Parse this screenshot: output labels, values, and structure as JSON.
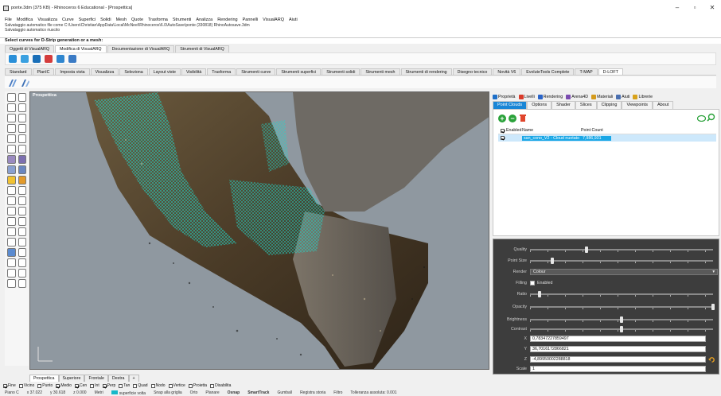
{
  "window": {
    "title": "ponte.3dm (375 KB) - Rhinoceros 6 Educational - [Prospettica]",
    "buttons": [
      "–",
      "▫",
      "✕"
    ]
  },
  "menu": [
    "File",
    "Modifica",
    "Visualizza",
    "Curve",
    "Superfici",
    "Solidi",
    "Mesh",
    "Quote",
    "Trasforma",
    "Strumenti",
    "Analizza",
    "Rendering",
    "Pannelli",
    "VisualARQ",
    "Aiuti"
  ],
  "command_history": [
    "Salvataggio automatico file come C:\\Users\\Christian\\AppData\\Local\\McNeel\\Rhinoceros\\6.0\\AutoSave\\ponte (330818) RhinoAutosave.3dm",
    "Salvataggio automatico riuscito"
  ],
  "command_prompt": "Select curves for D-Strip generation or a mesh:",
  "toolbar_tabs_top": [
    "Oggetti di VisualARQ",
    "Modifica di VisualARQ",
    "Documentazione di VisualARQ",
    "Strumenti di VisualARQ"
  ],
  "toolbar_tabs_top_active": 1,
  "toolbar_tabs_main": [
    "Standard",
    "PlanIC",
    "Imposta vista",
    "Visualizza",
    "Seleziona",
    "Layout viste",
    "Visibilità",
    "Trasforma",
    "Strumenti curve",
    "Strumenti superfici",
    "Strumenti solidi",
    "Strumenti mesh",
    "Strumenti di rendering",
    "Disegno tecnico",
    "Novità V6",
    "EvoluteTools Complete",
    "T-MAP",
    "D-LOFT"
  ],
  "toolbar_tabs_main_active": 17,
  "viewport": {
    "label": "Prospettica",
    "tabs": [
      "Prospettica",
      "Superiore",
      "Frontale",
      "Destra",
      "+"
    ],
    "active_tab": 0
  },
  "osnaps": [
    {
      "label": "Fine",
      "checked": true
    },
    {
      "label": "Vicino",
      "checked": false
    },
    {
      "label": "Punto",
      "checked": false
    },
    {
      "label": "Medio",
      "checked": true
    },
    {
      "label": "Cen",
      "checked": true
    },
    {
      "label": "Int",
      "checked": false
    },
    {
      "label": "Perp",
      "checked": true
    },
    {
      "label": "Tan",
      "checked": false
    },
    {
      "label": "Quad",
      "checked": false
    },
    {
      "label": "Nodo",
      "checked": false
    },
    {
      "label": "Vertice",
      "checked": false
    },
    {
      "label": "Proietta",
      "checked": false
    },
    {
      "label": "Disabilita",
      "checked": false
    }
  ],
  "status": {
    "plane": "Piano C",
    "x": "x 37.022",
    "y": "y 30.618",
    "z": "z 0.000",
    "units": "Metri",
    "layer": "superficie volta",
    "items": [
      "Snap alla griglia",
      "Orto",
      "Planare",
      "Osnap",
      "SmartTrack",
      "Gumball",
      "Registra storia",
      "Filtro",
      "Tolleranza assoluta: 0.001"
    ]
  },
  "panel_tabs": [
    {
      "label": "Proprietà",
      "color": "#1e6fc8"
    },
    {
      "label": "Livelli",
      "color": "#d93a2a"
    },
    {
      "label": "Rendering",
      "color": "#2a64c8"
    },
    {
      "label": "Arena4D",
      "color": "#7a4bb0"
    },
    {
      "label": "Materiali",
      "color": "#d49a1c"
    },
    {
      "label": "Aiuti",
      "color": "#4a6fb0"
    },
    {
      "label": "Librerie",
      "color": "#d8a21a"
    }
  ],
  "pc_subtabs": [
    "Point Clouds",
    "Options",
    "Shader",
    "Slices",
    "Clipping",
    "Viewpoints",
    "About"
  ],
  "pc_subtabs_active": 0,
  "pc_table": {
    "headers": [
      "Enabled",
      "Name",
      "Point Count"
    ],
    "rows": [
      {
        "enabled": true,
        "name": "san_cono_V2 - Cloud nuotato",
        "count": "7,986,931"
      }
    ]
  },
  "settings": {
    "quality": {
      "label": "Quality",
      "value": 0.31
    },
    "point_size": {
      "label": "Point Size",
      "value": 0.12
    },
    "render": {
      "label": "Render",
      "value": "Colour"
    },
    "filling": {
      "label": "Filling",
      "option": "Enabled"
    },
    "ratio": {
      "label": "Ratio",
      "value": 0.05
    },
    "opacity": {
      "label": "Opacity",
      "value": 1.0
    },
    "brightness": {
      "label": "Brightness",
      "value": 0.5
    },
    "contrast": {
      "label": "Contrast",
      "value": 0.5
    },
    "x": {
      "label": "X",
      "value": "0,78347227859497"
    },
    "y": {
      "label": "Y",
      "value": "36,7016172866821"
    },
    "z": {
      "label": "Z",
      "value": "-4,89950002288818"
    },
    "scale": {
      "label": "Scale",
      "value": "1"
    }
  }
}
